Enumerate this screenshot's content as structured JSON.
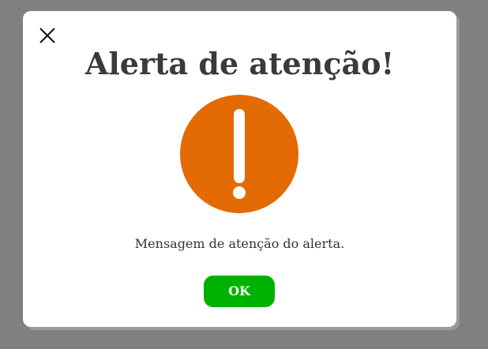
{
  "dialog": {
    "title": "Alerta de atenção!",
    "message": "Mensagem de atenção do alerta.",
    "ok_label": "OK",
    "close_icon": "close-icon",
    "alert_icon": "exclamation-icon"
  },
  "colors": {
    "backdrop": "#808080",
    "dialog_background": "#ffffff",
    "title_text": "#3a3a3a",
    "alert_icon": "#e46a03",
    "ok_button": "#00b200",
    "ok_text": "#ffffff"
  }
}
